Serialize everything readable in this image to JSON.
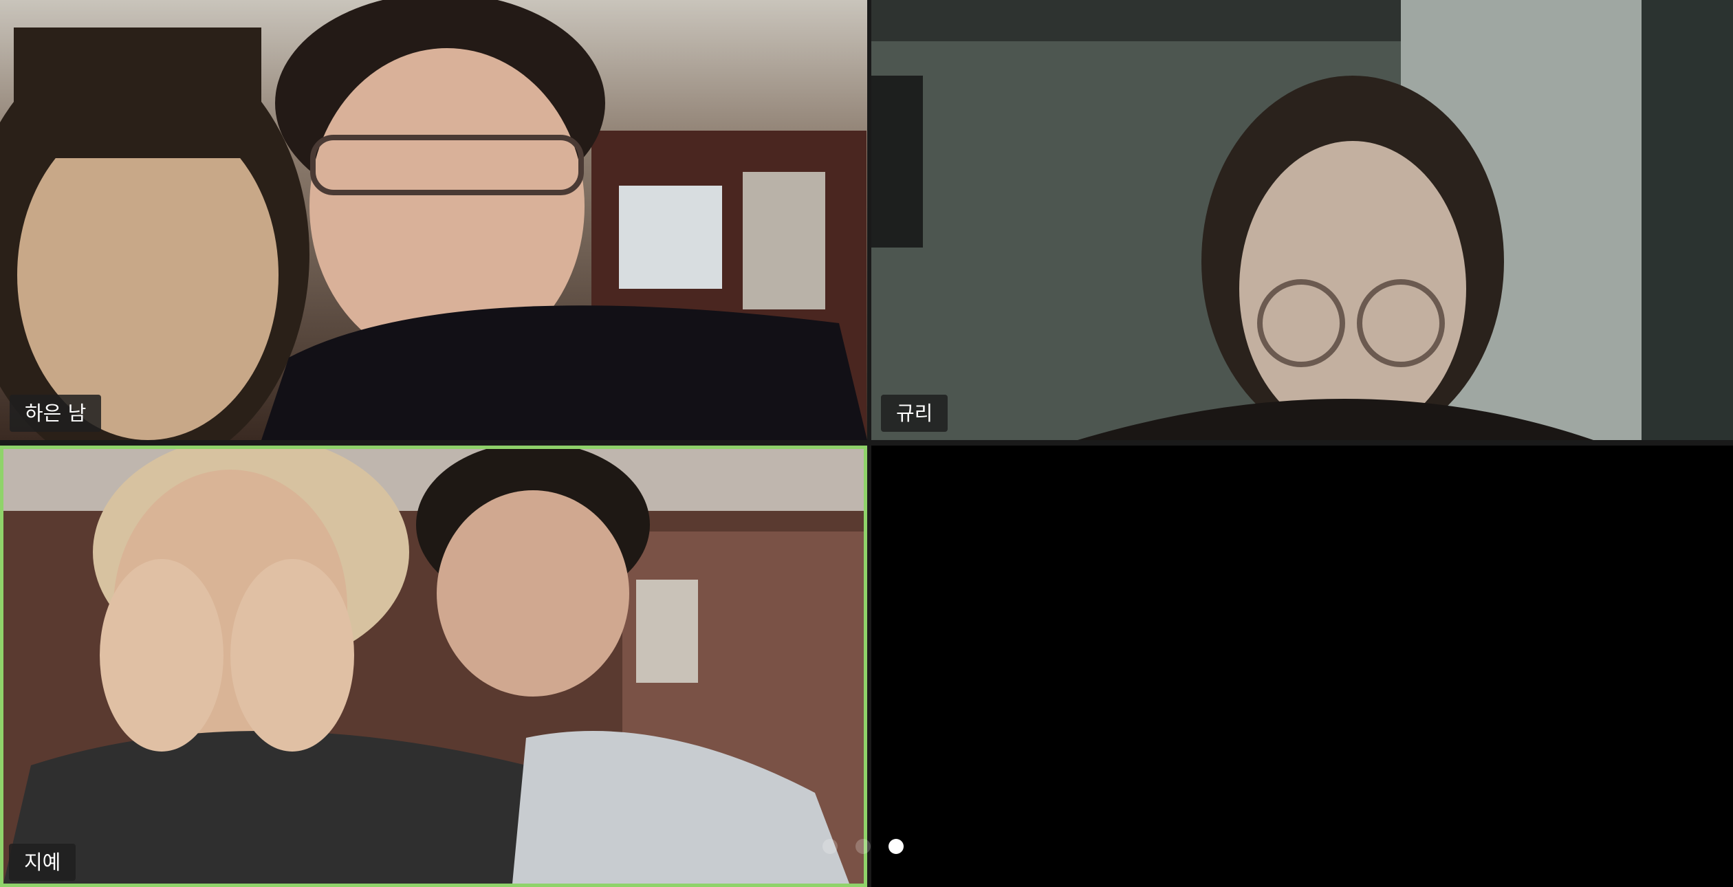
{
  "participants": [
    {
      "name": "하은 남",
      "active_speaker": false
    },
    {
      "name": "규리",
      "active_speaker": false
    },
    {
      "name": "지예",
      "active_speaker": true
    }
  ],
  "pagination": {
    "pages": 3,
    "current_page": 3
  },
  "colors": {
    "active_speaker_border": "#8fd36a",
    "label_background": "#1e1e1e",
    "background": "#000000"
  }
}
